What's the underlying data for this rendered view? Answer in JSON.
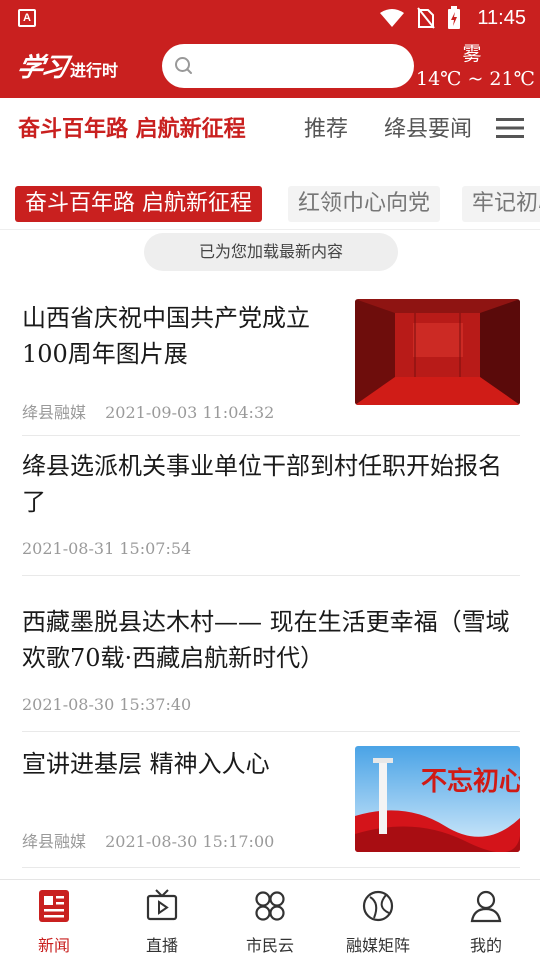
{
  "status_bar": {
    "app_icon_letter": "A",
    "time": "11:45"
  },
  "header": {
    "logo_script": "学习",
    "logo_text": "进行时",
    "search": {
      "placeholder": ""
    },
    "weather": {
      "condition": "雾",
      "temperature": "14℃ ~ 21℃"
    }
  },
  "channels": {
    "tabs": [
      {
        "label": "奋斗百年路 启航新征程",
        "active": true
      },
      {
        "label": "推荐",
        "active": false
      },
      {
        "label": "绛县要闻",
        "active": false
      }
    ],
    "menu_icon": "hamburger-icon"
  },
  "subchannels": [
    {
      "label": "奋斗百年路 启航新征程",
      "active": true
    },
    {
      "label": "红领巾心向党",
      "active": false
    },
    {
      "label": "牢记初心",
      "active": false
    }
  ],
  "toast": "已为您加载最新内容",
  "news": [
    {
      "title": "山西省庆祝中国共产党成立100周年图片展",
      "source": "绛县融媒",
      "time": "2021-09-03 11:04:32",
      "has_image": true
    },
    {
      "title": "绛县选派机关事业单位干部到村任职开始报名了",
      "source": "",
      "time": "2021-08-31 15:07:54",
      "has_image": false
    },
    {
      "title": "西藏墨脱县达木村—— 现在生活更幸福（雪域欢歌70载·西藏启航新时代）",
      "source": "",
      "time": "2021-08-30 15:37:40",
      "has_image": false
    },
    {
      "title": "宣讲进基层 精神入人心",
      "source": "绛县融媒",
      "time": "2021-08-30 15:17:00",
      "has_image": true,
      "image_text": "不忘初心 牢记使命"
    }
  ],
  "bottom_nav": [
    {
      "label": "新闻",
      "icon": "news-icon",
      "active": true
    },
    {
      "label": "直播",
      "icon": "tv-icon",
      "active": false
    },
    {
      "label": "市民云",
      "icon": "clover-icon",
      "active": false
    },
    {
      "label": "融媒矩阵",
      "icon": "matrix-icon",
      "active": false
    },
    {
      "label": "我的",
      "icon": "user-icon",
      "active": false
    }
  ],
  "colors": {
    "brand": "#c9201f",
    "inactive_text": "#555555",
    "meta_text": "#9a9a9a"
  }
}
